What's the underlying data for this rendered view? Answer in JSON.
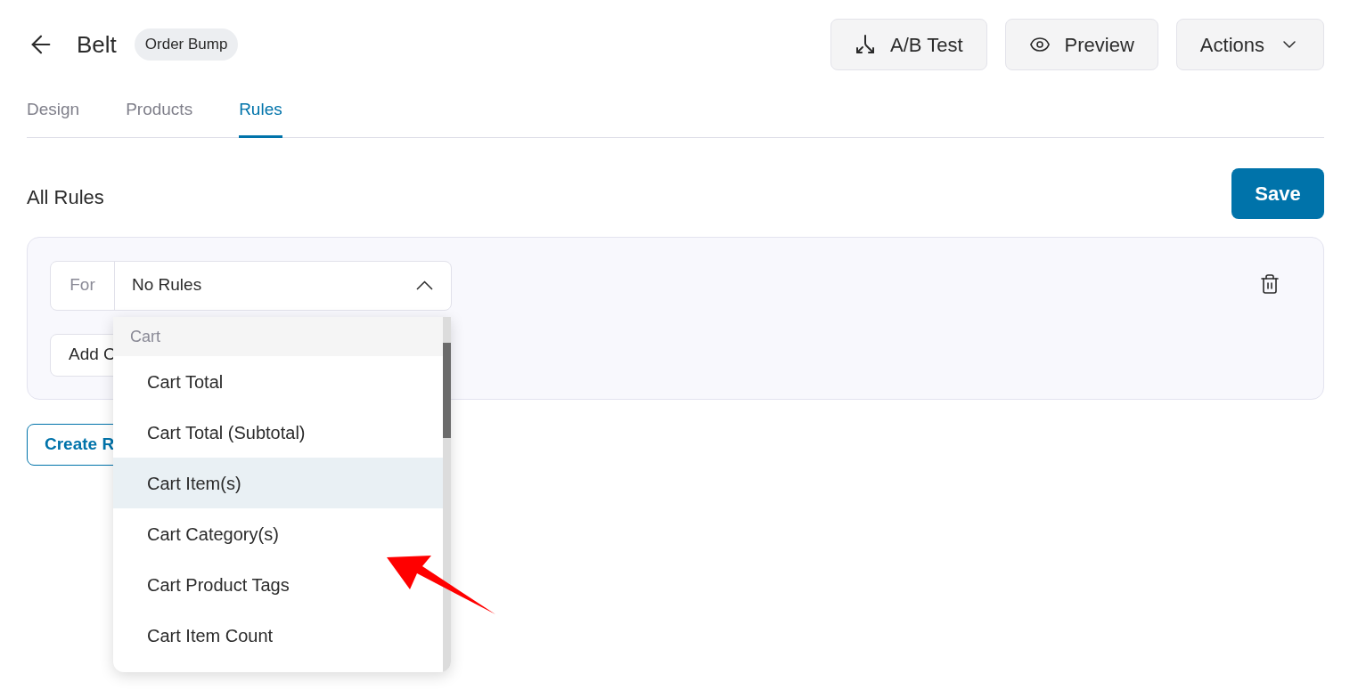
{
  "header": {
    "title": "Belt",
    "badge": "Order Bump",
    "buttons": [
      {
        "kind": "ab",
        "label": "A/B Test"
      },
      {
        "kind": "preview",
        "label": "Preview"
      },
      {
        "kind": "actions",
        "label": "Actions"
      }
    ]
  },
  "tabs": [
    {
      "label": "Design",
      "selected": false
    },
    {
      "label": "Products",
      "selected": false
    },
    {
      "label": "Rules",
      "selected": true
    }
  ],
  "section_title": "All Rules",
  "save_button": "Save",
  "rule": {
    "for_label": "For",
    "select_value": "No Rules",
    "expanded": true,
    "add_button": "Add C"
  },
  "create_button": "Create R",
  "menu": {
    "group": "Cart",
    "items": [
      {
        "label": "Cart Total",
        "selected": false
      },
      {
        "label": "Cart Total (Subtotal)",
        "selected": false
      },
      {
        "label": "Cart Item(s)",
        "selected": true
      },
      {
        "label": "Cart Category(s)",
        "selected": false
      },
      {
        "label": "Cart Product Tags",
        "selected": false
      },
      {
        "label": "Cart Item Count",
        "selected": false
      }
    ]
  }
}
